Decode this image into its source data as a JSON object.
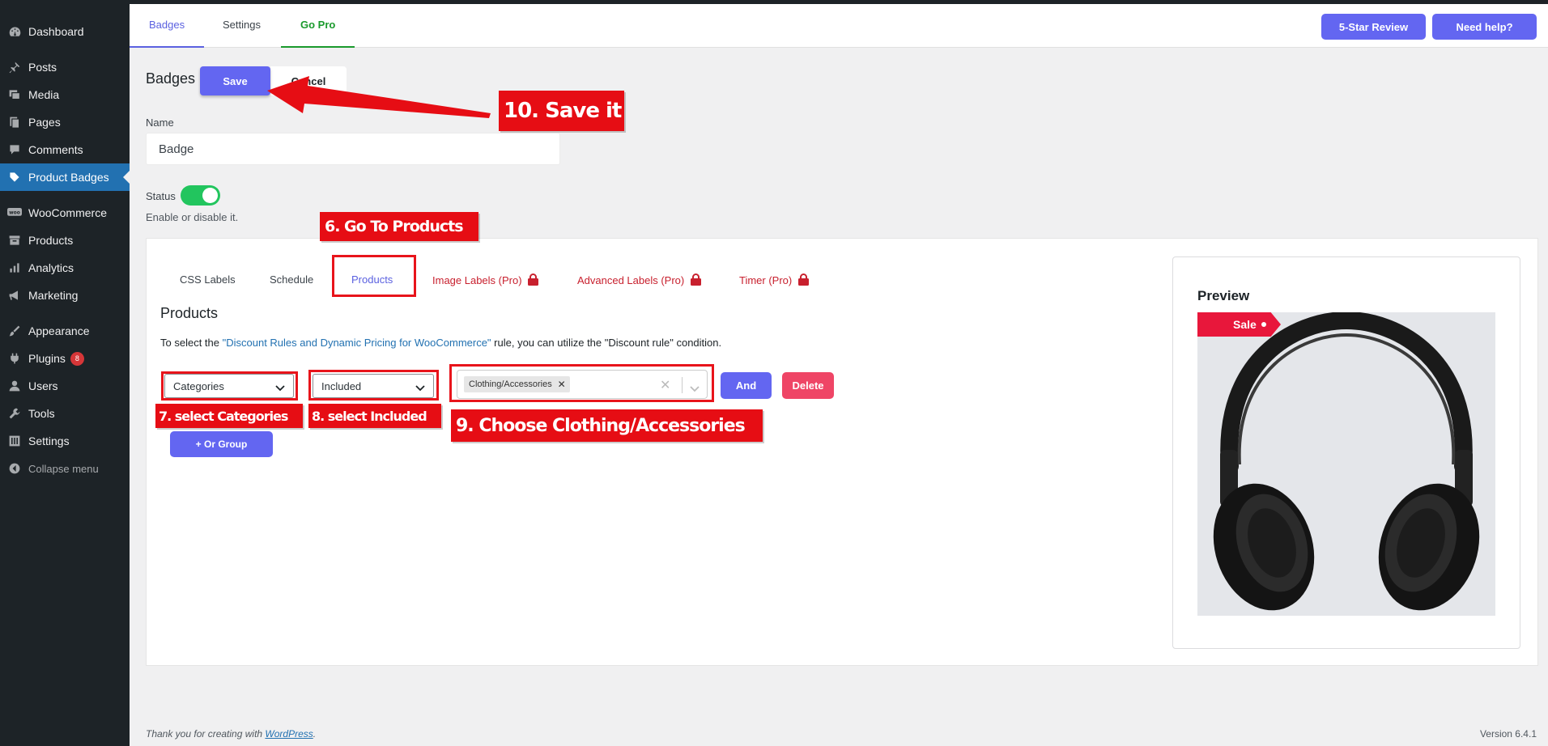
{
  "sidebar": {
    "items": [
      {
        "label": "Dashboard",
        "icon": "dashboard-icon"
      },
      {
        "label": "Posts",
        "icon": "pin-icon"
      },
      {
        "label": "Media",
        "icon": "media-icon"
      },
      {
        "label": "Pages",
        "icon": "pages-icon"
      },
      {
        "label": "Comments",
        "icon": "comment-icon"
      },
      {
        "label": "Product Badges",
        "icon": "badge-icon"
      },
      {
        "label": "WooCommerce",
        "icon": "woo-icon"
      },
      {
        "label": "Products",
        "icon": "archive-icon"
      },
      {
        "label": "Analytics",
        "icon": "chart-icon"
      },
      {
        "label": "Marketing",
        "icon": "megaphone-icon"
      },
      {
        "label": "Appearance",
        "icon": "brush-icon"
      },
      {
        "label": "Plugins",
        "icon": "plugin-icon",
        "count": "8"
      },
      {
        "label": "Users",
        "icon": "user-icon"
      },
      {
        "label": "Tools",
        "icon": "wrench-icon"
      },
      {
        "label": "Settings",
        "icon": "settings-icon"
      }
    ],
    "collapse_label": "Collapse menu"
  },
  "header": {
    "tabs": [
      "Badges",
      "Settings",
      "Go Pro"
    ],
    "review_button": "5-Star Review",
    "help_button": "Need help?"
  },
  "page": {
    "title": "Badges",
    "save_label": "Save",
    "cancel_label": "Cancel",
    "name_label": "Name",
    "name_value": "Badge",
    "status_label": "Status",
    "status_on": true,
    "status_help": "Enable or disable it."
  },
  "rule_tabs": [
    {
      "label": "CSS Labels"
    },
    {
      "label": "Schedule"
    },
    {
      "label": "Products"
    },
    {
      "label": "Image Labels (Pro)"
    },
    {
      "label": "Advanced Labels (Pro)"
    },
    {
      "label": "Timer (Pro)"
    }
  ],
  "products": {
    "title": "Products",
    "help_prefix": "To select the ",
    "help_link": "\"Discount Rules and Dynamic Pricing for WooCommerce\"",
    "help_suffix": " rule, you can utilize the \"Discount rule\" condition.",
    "condition_type": "Categories",
    "operator": "Included",
    "chip_value": "Clothing/Accessories",
    "and_label": "And",
    "delete_label": "Delete",
    "or_group_label": "+ Or Group"
  },
  "preview": {
    "title": "Preview",
    "badge_label": "Sale"
  },
  "footer": {
    "thanks_prefix": "Thank you for creating with ",
    "thanks_link": "WordPress",
    "thanks_suffix": ".",
    "version": "Version 6.4.1"
  },
  "annotations": {
    "step6": "6. Go To Products",
    "step7": "7. select Categories",
    "step8": "8. select Included",
    "step9": "9. Choose Clothing/Accessories",
    "step10": "10. Save it"
  },
  "colors": {
    "accent": "#6366f1",
    "wp_blue": "#2271b1",
    "sidebar_bg": "#1d2327",
    "go_pro": "#1a9a2c",
    "pro_red": "#c8202e",
    "delete": "#ef4566",
    "toggle_on": "#22c55e",
    "annotation_red": "#e60d14"
  }
}
